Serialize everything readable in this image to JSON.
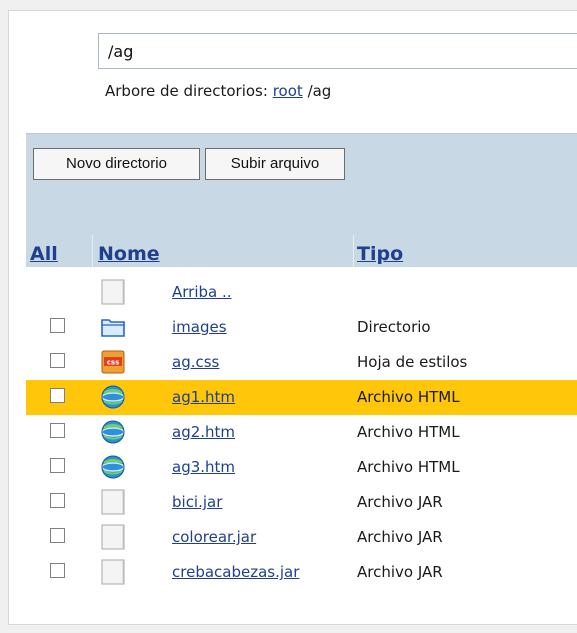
{
  "path_field": {
    "value": "/ag"
  },
  "breadcrumb": {
    "prefix": "Arbore de directorios:",
    "root_label": "root",
    "current": "/ag"
  },
  "toolbar": {
    "new_dir_label": "Novo directorio",
    "upload_label": "Subir arquivo"
  },
  "table": {
    "headers": {
      "all": "All",
      "name": "Nome",
      "type": "Tipo"
    },
    "rows": [
      {
        "name": "Arriba ..",
        "type": "",
        "icon": "blank-file-icon",
        "has_checkbox": false,
        "selected": false
      },
      {
        "name": "images",
        "type": "Directorio",
        "icon": "folder-icon",
        "has_checkbox": true,
        "selected": false
      },
      {
        "name": "ag.css",
        "type": "Hoja de estilos",
        "icon": "css-file-icon",
        "has_checkbox": true,
        "selected": false
      },
      {
        "name": "ag1.htm",
        "type": "Archivo HTML",
        "icon": "html-globe-icon",
        "has_checkbox": true,
        "selected": true
      },
      {
        "name": "ag2.htm",
        "type": "Archivo HTML",
        "icon": "html-globe-icon",
        "has_checkbox": true,
        "selected": false
      },
      {
        "name": "ag3.htm",
        "type": "Archivo HTML",
        "icon": "html-globe-icon",
        "has_checkbox": true,
        "selected": false
      },
      {
        "name": "bici.jar",
        "type": "Archivo JAR",
        "icon": "blank-file-icon",
        "has_checkbox": true,
        "selected": false
      },
      {
        "name": "colorear.jar",
        "type": "Archivo JAR",
        "icon": "blank-file-icon",
        "has_checkbox": true,
        "selected": false
      },
      {
        "name": "crebacabezas.jar",
        "type": "Archivo JAR",
        "icon": "blank-file-icon",
        "has_checkbox": true,
        "selected": false
      }
    ]
  },
  "colors": {
    "link": "#1f3f8f",
    "band": "#c8d8e4",
    "selected_row": "#ffc60a"
  }
}
